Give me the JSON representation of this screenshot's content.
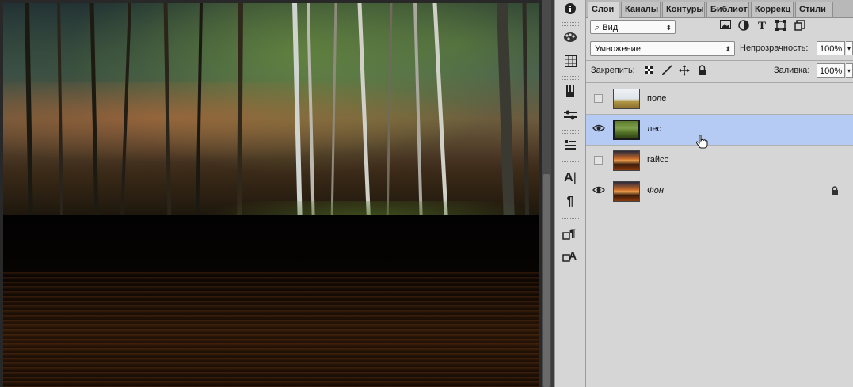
{
  "panel": {
    "tabs": [
      {
        "label": "Слои",
        "active": true
      },
      {
        "label": "Каналы"
      },
      {
        "label": "Контуры"
      },
      {
        "label": "Библиотек"
      },
      {
        "label": "Коррекц"
      },
      {
        "label": "Стили"
      }
    ],
    "filter_label": "Вид",
    "blend_mode": "Умножение",
    "opacity_label": "Непрозрачность:",
    "opacity_value": "100%",
    "lock_label": "Закрепить:",
    "fill_label": "Заливка:",
    "fill_value": "100%"
  },
  "layers": [
    {
      "name": "поле",
      "visible": false,
      "selected": false,
      "locked": false,
      "italic": false,
      "thumb": "field"
    },
    {
      "name": "лес",
      "visible": true,
      "selected": true,
      "locked": false,
      "italic": false,
      "thumb": "forest"
    },
    {
      "name": "гайсс",
      "visible": false,
      "selected": false,
      "locked": false,
      "italic": false,
      "thumb": "sunset"
    },
    {
      "name": "Фон",
      "visible": true,
      "selected": false,
      "locked": true,
      "italic": true,
      "thumb": "sunset"
    }
  ],
  "icons": {
    "filter": "search-icon",
    "kind": [
      "image-filter-icon",
      "adjustment-filter-icon",
      "type-filter-icon",
      "shape-filter-icon",
      "smart-object-filter-icon"
    ],
    "lock": [
      "lock-transparent-icon",
      "lock-brush-icon",
      "lock-move-icon",
      "lock-all-icon"
    ],
    "tools": [
      "info-icon",
      "swatches-icon",
      "grid-icon",
      "brush-presets-icon",
      "adjust-icon",
      "layer-comps-icon",
      "character-icon",
      "paragraph-icon",
      "paragraph-style-icon",
      "character-style-icon"
    ]
  },
  "colors": {
    "selected_layer": "#b5cbf3",
    "panel_bg": "#d6d6d6"
  }
}
